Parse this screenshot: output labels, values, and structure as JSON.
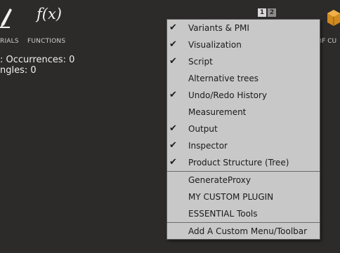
{
  "toolbar": {
    "materials_label": "RIALS",
    "functions_label": "FUNCTIONS",
    "partial_label": "BF CU",
    "page_toggle": [
      "1",
      "2"
    ]
  },
  "stats": {
    "occurrences": ": Occurrences: 0",
    "triangles": "ngles: 0"
  },
  "menu": {
    "items": [
      {
        "label": "Variants & PMI",
        "checked": true
      },
      {
        "label": "Visualization",
        "checked": true
      },
      {
        "label": "Script",
        "checked": true
      },
      {
        "label": "Alternative trees",
        "checked": false
      },
      {
        "label": "Undo/Redo History",
        "checked": true
      },
      {
        "label": "Measurement",
        "checked": false
      },
      {
        "label": "Output",
        "checked": true
      },
      {
        "label": "Inspector",
        "checked": true
      },
      {
        "label": "Product Structure (Tree)",
        "checked": true
      },
      {
        "label": "GenerateProxy",
        "checked": false
      },
      {
        "label": "MY CUSTOM PLUGIN",
        "checked": false
      },
      {
        "label": "ESSENTIAL Tools",
        "checked": false
      },
      {
        "label": "Add A Custom Menu/Toolbar",
        "checked": false
      }
    ],
    "check_glyph": "✔"
  }
}
